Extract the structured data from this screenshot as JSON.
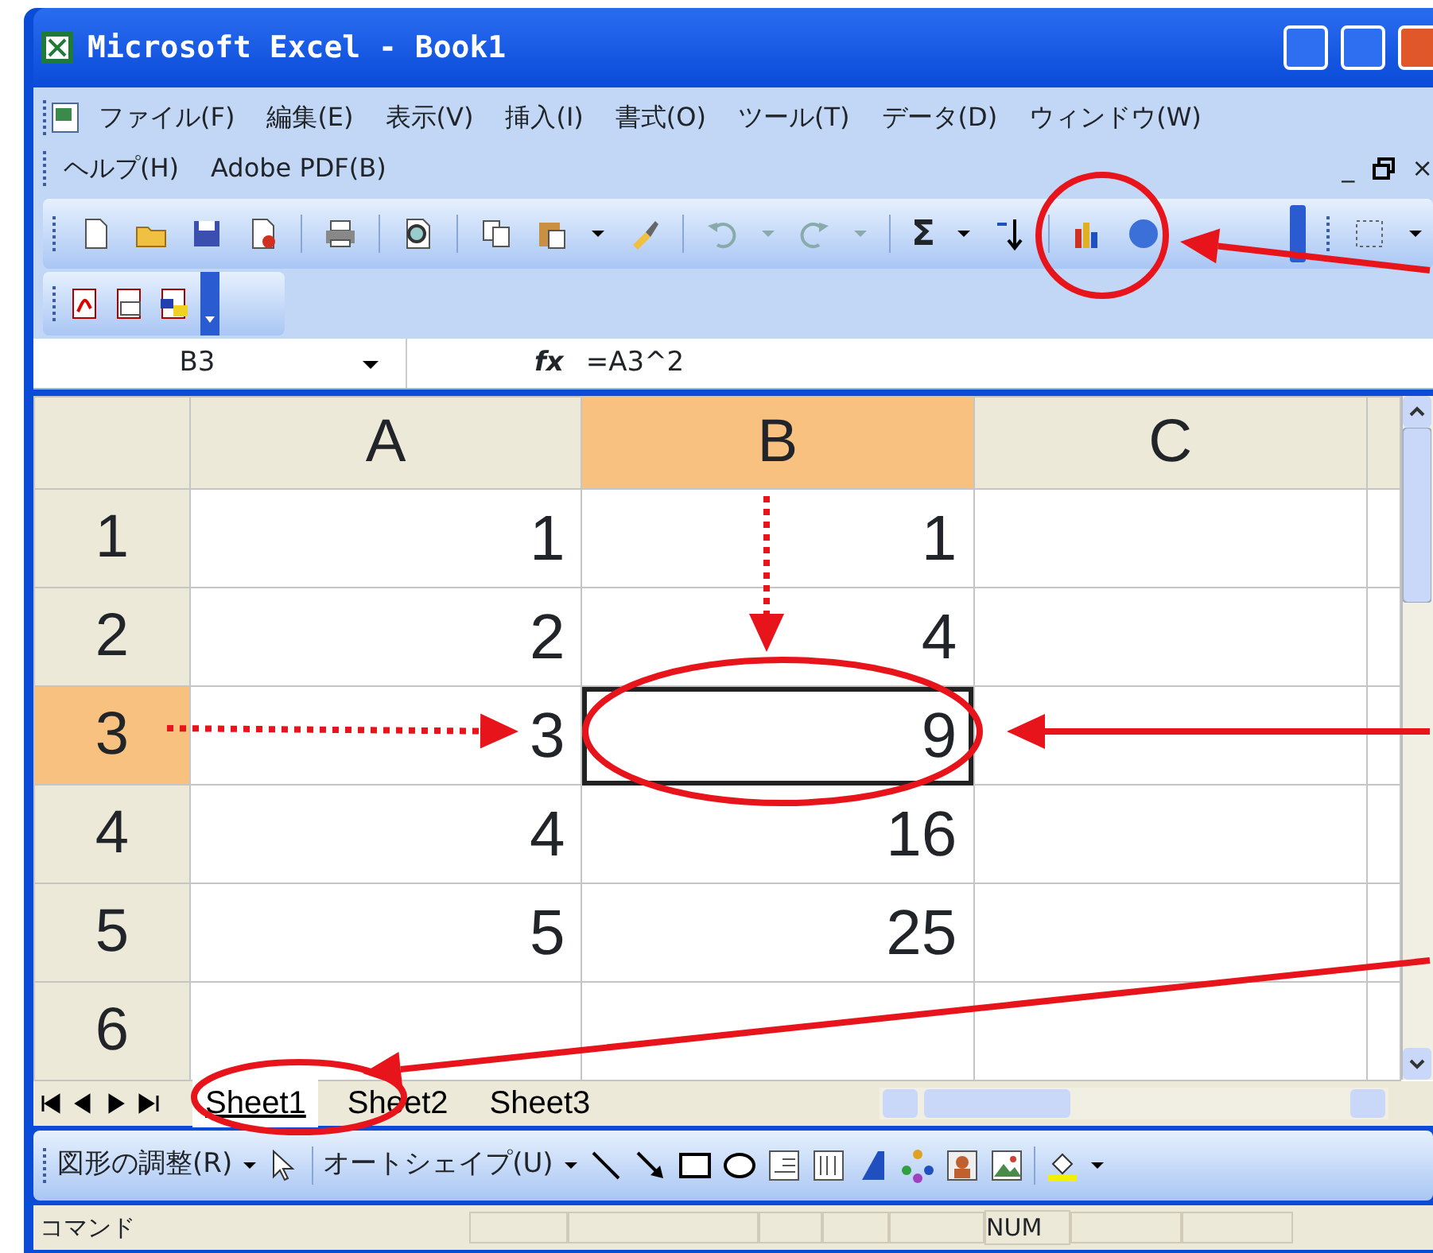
{
  "window": {
    "title": "Microsoft Excel - Book1"
  },
  "menu": [
    {
      "label": "ファイル(F)"
    },
    {
      "label": "編集(E)"
    },
    {
      "label": "表示(V)"
    },
    {
      "label": "挿入(I)"
    },
    {
      "label": "書式(O)"
    },
    {
      "label": "ツール(T)"
    },
    {
      "label": "データ(D)"
    },
    {
      "label": "ウィンドウ(W)"
    },
    {
      "label": "ヘルプ(H)"
    },
    {
      "label": "Adobe PDF(B)"
    }
  ],
  "document_controls": {
    "minimize": "_",
    "close": "×"
  },
  "toolbar": {
    "sum": "Σ"
  },
  "formula_bar": {
    "name_box": "B3",
    "function_label": "fx",
    "formula": "=A3^2"
  },
  "columns": [
    {
      "label": "A",
      "selected": false
    },
    {
      "label": "B",
      "selected": true
    },
    {
      "label": "C",
      "selected": false
    }
  ],
  "rows": [
    {
      "label": "1",
      "selected": false,
      "cells": [
        {
          "value": "1",
          "active": false
        },
        {
          "value": "1",
          "active": false
        }
      ]
    },
    {
      "label": "2",
      "selected": false,
      "cells": [
        {
          "value": "2",
          "active": false
        },
        {
          "value": "4",
          "active": false
        }
      ]
    },
    {
      "label": "3",
      "selected": true,
      "cells": [
        {
          "value": "3",
          "active": false
        },
        {
          "value": "9",
          "active": true
        }
      ]
    },
    {
      "label": "4",
      "selected": false,
      "cells": [
        {
          "value": "4",
          "active": false
        },
        {
          "value": "16",
          "active": false
        }
      ]
    },
    {
      "label": "5",
      "selected": false,
      "cells": [
        {
          "value": "5",
          "active": false
        },
        {
          "value": "25",
          "active": false
        }
      ]
    },
    {
      "label": "6",
      "selected": false,
      "cells": []
    }
  ],
  "sheet_tabs": [
    {
      "label": "Sheet1",
      "selected": true
    },
    {
      "label": "Sheet2",
      "selected": false
    },
    {
      "label": "Sheet3",
      "selected": false
    }
  ],
  "drawing_toolbar": {
    "draw_menu": "図形の調整(R)",
    "autoshapes": "オートシェイプ(U)"
  },
  "status_bar": {
    "text": "コマンド",
    "num": "NUM"
  }
}
